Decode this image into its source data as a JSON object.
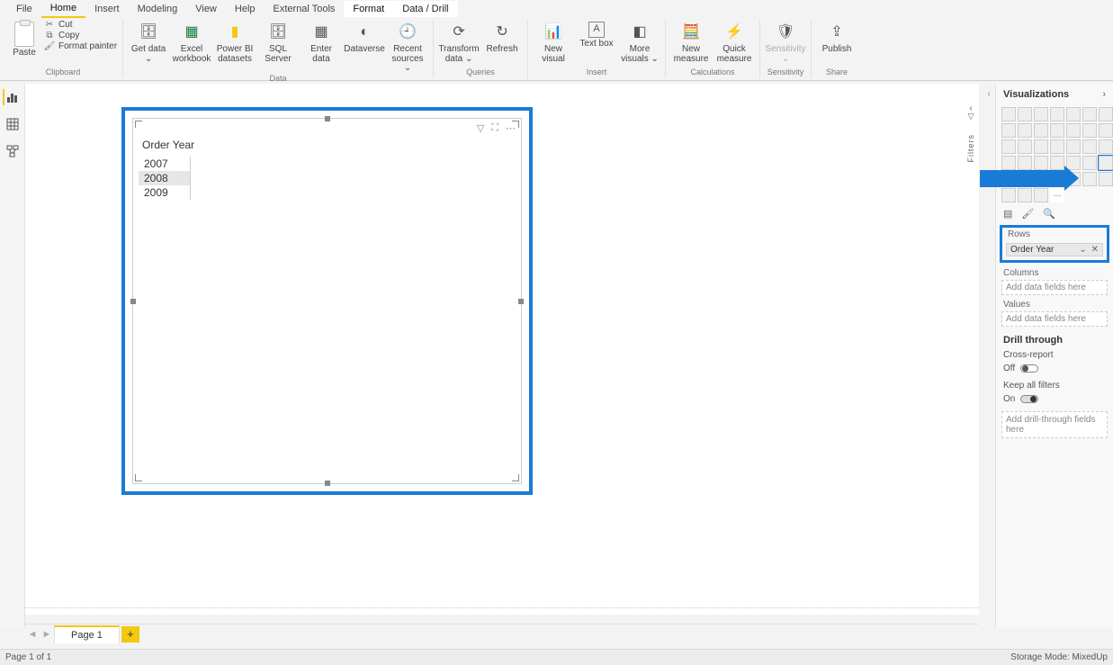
{
  "tabs": {
    "file": "File",
    "home": "Home",
    "insert": "Insert",
    "modeling": "Modeling",
    "view": "View",
    "help": "Help",
    "external": "External Tools",
    "format": "Format",
    "datadrill": "Data / Drill"
  },
  "ribbon": {
    "clipboard": {
      "paste": "Paste",
      "cut": "Cut",
      "copy": "Copy",
      "format_painter": "Format painter",
      "group": "Clipboard"
    },
    "data": {
      "get": "Get data ⌄",
      "excel": "Excel workbook",
      "pbi": "Power BI datasets",
      "sql": "SQL Server",
      "enter": "Enter data",
      "dataverse": "Dataverse",
      "recent": "Recent sources ⌄",
      "group": "Data"
    },
    "queries": {
      "transform": "Transform data ⌄",
      "refresh": "Refresh",
      "group": "Queries"
    },
    "insert": {
      "newvisual": "New visual",
      "textbox": "Text box",
      "more": "More visuals ⌄",
      "group": "Insert"
    },
    "calc": {
      "newmeasure": "New measure",
      "quick": "Quick measure",
      "group": "Calculations"
    },
    "sens": {
      "sensitivity": "Sensitivity ⌄",
      "group": "Sensitivity"
    },
    "share": {
      "publish": "Publish",
      "group": "Share"
    }
  },
  "filters_tab": "Filters",
  "visual": {
    "title": "Order Year",
    "years": [
      "2007",
      "2008",
      "2009"
    ],
    "selected_index": 1
  },
  "viz_pane": {
    "title": "Visualizations",
    "rows_label": "Rows",
    "rows_field": "Order Year",
    "columns_label": "Columns",
    "columns_placeholder": "Add data fields here",
    "values_label": "Values",
    "values_placeholder": "Add data fields here",
    "drill_title": "Drill through",
    "cross_report": "Cross-report",
    "cross_state": "Off",
    "keep_filters": "Keep all filters",
    "keep_state": "On",
    "drill_placeholder": "Add drill-through fields here"
  },
  "pagebar": {
    "page1": "Page 1"
  },
  "status": {
    "left": "Page 1 of 1",
    "right": "Storage Mode: MixedUp"
  }
}
